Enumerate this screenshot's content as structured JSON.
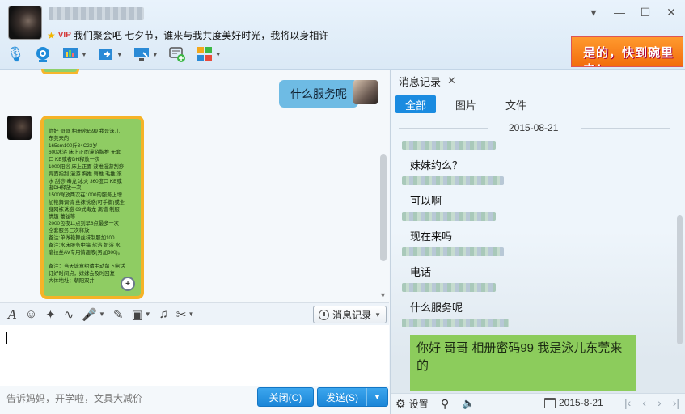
{
  "header": {
    "signature": "我们聚会吧 七夕节，谁来与我共度美好时光，我将以身相许",
    "vip_badge": "VIP",
    "ad_text": "是的，快到碗里来！"
  },
  "window_controls": [
    "▾",
    "—",
    "☐",
    "✕"
  ],
  "chat": {
    "outgoing_message": "什么服务呢",
    "image_message_lines": [
      "你好 哥哥 相册密码99 我是泳儿",
      "东莞来的",
      "165cm100斤34C23岁",
      "600冰浴 床上正面漫游胸推 无套",
      "口 KB或者DH释放一次",
      "1000阳浴 床上正面 波推漫游刮痧",
      "背面指刮 漫游 胸推 臀推 毛推 滚",
      "水 刮痧 毒龙 冰火 360度口 KB或",
      "者DH释放一次",
      "1500臀放两次在1000的服务上增",
      "加艳舞调情 丝袜诱惑(可手撕)或全",
      "身网袜诱惑 69式毒龙 离谱 制服",
      "情趣 蕾丝等",
      "2000包夜11点到早8点最多一次",
      "全套服务三次释放",
      "备注:单做艳舞丝袜制服加100",
      "备注:水床服务中搞 盐浴 奶浴 水",
      "磨拉丝AV专用情趣液(另加300)。",
      "",
      "备注：当天诚意约请主动留下电话",
      "订好时间点，妹妹会及时回复",
      "大体地址：朝阳双井"
    ]
  },
  "input_toolbar": {
    "history_label": "消息记录"
  },
  "bottom": {
    "ad_line": "告诉妈妈，开学啦，文具大减价",
    "close_label": "关闭(C)",
    "send_label": "发送(S)"
  },
  "panel": {
    "tab_title": "消息记录",
    "filters": [
      "全部",
      "图片",
      "文件"
    ],
    "date": "2015-08-21",
    "messages": [
      "妹妹约么？",
      "可以啊",
      "现在来吗",
      "电话",
      "什么服务呢"
    ],
    "card_text": "你好 哥哥 相册密码99 我是泳儿东莞来的",
    "footer_settings": "设置",
    "footer_date": "2015-8-21"
  },
  "colors": {
    "accent_blue": "#1a8be0",
    "bubble_blue": "#6ebbe4",
    "image_green": "#8fcc63",
    "image_border": "#f5b327"
  }
}
